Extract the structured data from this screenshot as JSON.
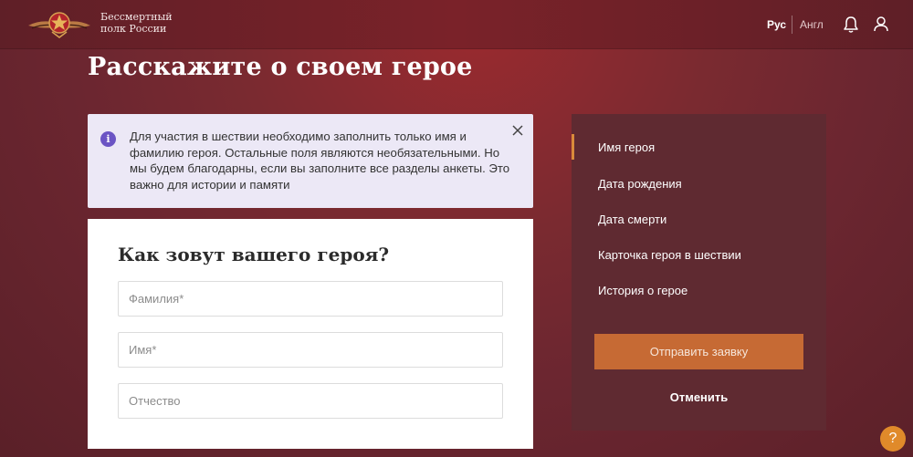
{
  "header": {
    "brand_line1": "Бессмертный",
    "brand_line2": "полк России",
    "lang_ru": "Рус",
    "lang_en": "Англ",
    "icons": [
      "logo-emblem",
      "bell-icon",
      "user-icon"
    ]
  },
  "page": {
    "title": "Расскажите о своем герое"
  },
  "info": {
    "text": "Для участия в шествии необходимо заполнить только имя и фамилию героя. Остальные поля являются необязательными. Но мы будем благодарны, если вы заполните все разделы анкеты. Это важно для истории и памяти",
    "icon_glyph": "i",
    "accent": "#6b54c4"
  },
  "form": {
    "title": "Как зовут вашего героя?",
    "fields": [
      {
        "placeholder": "Фамилия*",
        "value": ""
      },
      {
        "placeholder": "Имя*",
        "value": ""
      },
      {
        "placeholder": "Отчество",
        "value": ""
      }
    ]
  },
  "sidebar": {
    "items": [
      {
        "label": "Имя героя",
        "active": true
      },
      {
        "label": "Дата рождения",
        "active": false
      },
      {
        "label": "Дата смерти",
        "active": false
      },
      {
        "label": "Карточка героя в шествии",
        "active": false
      },
      {
        "label": "История о герое",
        "active": false
      }
    ],
    "submit_label": "Отправить заявку",
    "cancel_label": "Отменить"
  },
  "help": {
    "glyph": "?"
  },
  "colors": {
    "accent_orange": "#c66a34",
    "sidebar_bg": "#5f2a31",
    "active_marker": "#d98a3a"
  }
}
